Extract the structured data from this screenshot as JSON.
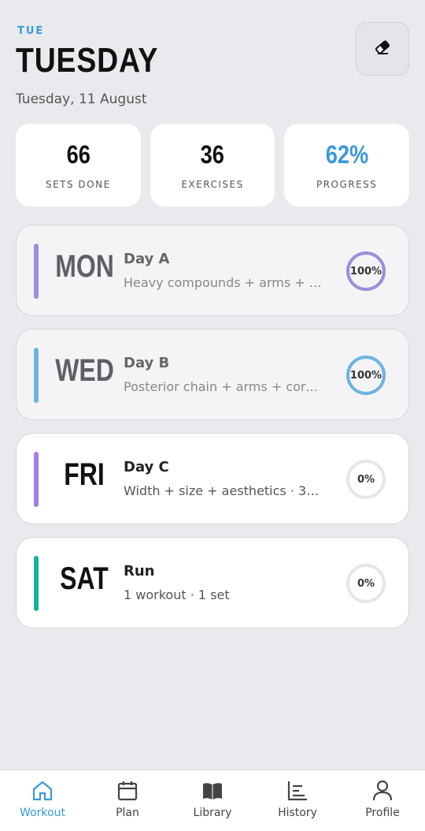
{
  "header": {
    "day_abbr": "TUE",
    "title": "TUESDAY",
    "date": "Tuesday, 11 August",
    "erase_icon": "eraser-icon"
  },
  "stats": [
    {
      "value": "66",
      "label": "SETS DONE"
    },
    {
      "value": "36",
      "label": "EXERCISES"
    },
    {
      "value": "62%",
      "label": "PROGRESS"
    }
  ],
  "workouts": [
    {
      "dow": "MON",
      "name": "Day A",
      "desc": "Heavy compounds + arms + c...",
      "progress_label": "100%",
      "progress": 1.0,
      "color": "#9b8fdc",
      "done": true
    },
    {
      "dow": "WED",
      "name": "Day B",
      "desc": "Posterior chain + arms + core ...",
      "progress_label": "100%",
      "progress": 1.0,
      "color": "#6fb3e3",
      "done": true
    },
    {
      "dow": "FRI",
      "name": "Day C",
      "desc": "Width + size + aesthetics · 39 ...",
      "progress_label": "0%",
      "progress": 0.0,
      "color": "#a77de0",
      "done": false
    },
    {
      "dow": "SAT",
      "name": "Run",
      "desc": "1 workout · 1 set",
      "progress_label": "0%",
      "progress": 0.0,
      "color": "#1aaf9c",
      "done": false
    }
  ],
  "tabs": [
    {
      "label": "Workout",
      "icon": "home-icon",
      "active": true
    },
    {
      "label": "Plan",
      "icon": "calendar-icon",
      "active": false
    },
    {
      "label": "Library",
      "icon": "book-icon",
      "active": false
    },
    {
      "label": "History",
      "icon": "history-chart-icon",
      "active": false
    },
    {
      "label": "Profile",
      "icon": "person-icon",
      "active": false
    }
  ],
  "colors": {
    "accent": "#3a9ad9",
    "ring_track": "#e6e6ea"
  }
}
